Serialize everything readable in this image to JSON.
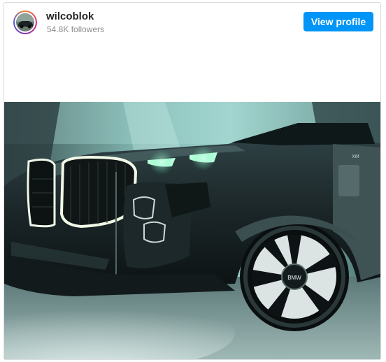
{
  "post_header": {
    "username": "wilcoblok",
    "followers": "54.8K followers",
    "view_profile_label": "View profile",
    "accent_color": "#0095f6"
  },
  "media": {
    "badge_text": "BMW",
    "model_script": "XM"
  }
}
